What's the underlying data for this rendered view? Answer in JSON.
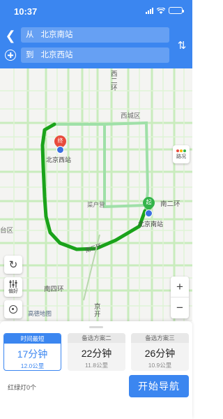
{
  "status_bar": {
    "time": "10:37"
  },
  "route": {
    "from_prefix": "从",
    "from_value": "北京南站",
    "to_prefix": "到",
    "to_value": "北京西站"
  },
  "map": {
    "labels": {
      "xierhuan": "西二环",
      "xicheng": "西城区",
      "west_station": "北京西站",
      "caihukou": "菜户营",
      "nanerhuan": "南二环",
      "south_station": "北京南站",
      "fengtai": "台区",
      "nansihuan": "南四环",
      "jingkai": "京开",
      "nansanhuan": "南三环"
    },
    "pin_end": "终",
    "pin_start": "起",
    "traffic_label": "路况",
    "preference_label": "偏好",
    "logo": "高德地图",
    "icons": {
      "traffic": "traffic-light-icon",
      "refresh": "refresh-icon",
      "preference": "sliders-icon",
      "locate": "locate-icon"
    },
    "colors": {
      "active_route": "#1aa31a",
      "alt_route": "#9fe0a8",
      "road": "#c9ecbd",
      "pin_end": "#e84b3c",
      "pin_start": "#33b44a"
    }
  },
  "plans": [
    {
      "tag": "时间最短",
      "time": "17分钟",
      "distance": "12.0公里",
      "active": true
    },
    {
      "tag": "备选方案二",
      "time": "22分钟",
      "distance": "11.8公里",
      "active": false
    },
    {
      "tag": "备选方案三",
      "time": "26分钟",
      "distance": "10.9公里",
      "active": false
    }
  ],
  "traffic_lights": "红绿灯0个",
  "start_button": "开始导航",
  "accent_color": "#3b86f0"
}
